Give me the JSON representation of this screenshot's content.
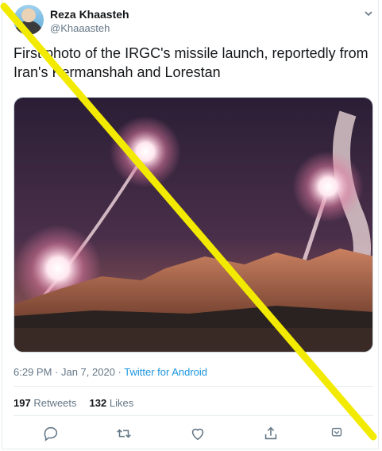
{
  "author": {
    "name": "Reza Khaasteh",
    "handle": "@Khaaasteh"
  },
  "tweet": {
    "text": "First photo of the IRGC's missile launch, reportedly from Iran's Kermanshah and Lorestan"
  },
  "meta": {
    "time": "6:29 PM",
    "separator": " · ",
    "date": "Jan 7, 2020",
    "source": "Twitter for Android"
  },
  "stats": {
    "retweets_count": "197",
    "retweets_label": "Retweets",
    "likes_count": "132",
    "likes_label": "Likes"
  },
  "icons": {
    "caret": "chevron-down-icon",
    "reply": "reply-icon",
    "retweet": "retweet-icon",
    "like": "heart-icon",
    "share": "share-icon",
    "menu": "dropdown-icon"
  },
  "colors": {
    "link": "#1b95e0",
    "muted": "#657786",
    "overlay_line": "#f2ea00"
  }
}
